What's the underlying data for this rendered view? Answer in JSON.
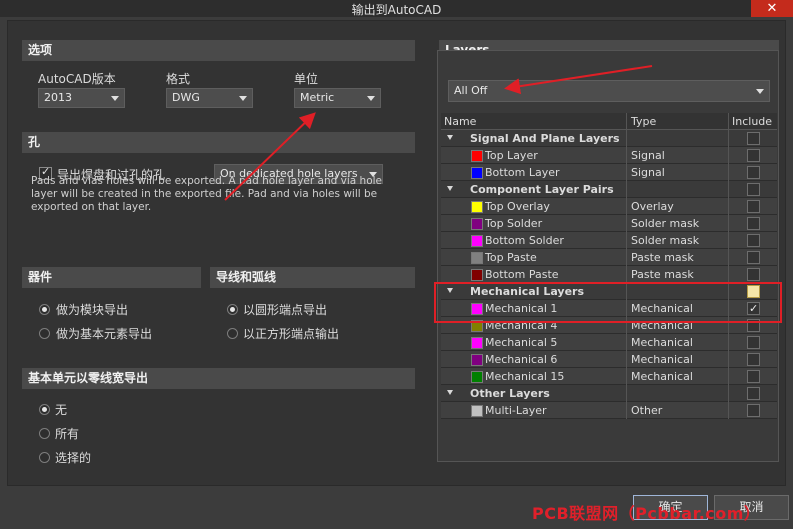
{
  "window": {
    "title": "输出到AutoCAD",
    "close_glyph": "✕"
  },
  "options": {
    "header": "选项",
    "autocad_version": {
      "label": "AutoCAD版本",
      "value": "2013"
    },
    "format": {
      "label": "格式",
      "value": "DWG"
    },
    "units": {
      "label": "单位",
      "value": "Metric"
    }
  },
  "holes": {
    "header": "孔",
    "export_checkbox_label": "导出焊盘和过孔的孔",
    "export_checked": true,
    "mode_value": "On dedicated hole layers",
    "description": "Pads and vias holes will be exported. A pad hole layer and via hole layer will be created in the exported file. Pad and via holes will be exported on that layer."
  },
  "components": {
    "header": "器件",
    "options": [
      {
        "label": "做为模块导出",
        "selected": true
      },
      {
        "label": "做为基本元素导出",
        "selected": false
      }
    ]
  },
  "tracks": {
    "header": "导线和弧线",
    "options": [
      {
        "label": "以圆形端点导出",
        "selected": true
      },
      {
        "label": "以正方形端点输出",
        "selected": false
      }
    ]
  },
  "zero_width": {
    "header": "基本单元以零线宽导出",
    "options": [
      {
        "label": "无",
        "selected": true
      },
      {
        "label": "所有",
        "selected": false
      },
      {
        "label": "选择的",
        "selected": false
      }
    ]
  },
  "layers": {
    "header": "Layers",
    "filter_value": "All Off",
    "columns": {
      "name": "Name",
      "type": "Type",
      "include": "Include"
    },
    "rows": [
      {
        "kind": "group",
        "name": "Signal And Plane Layers"
      },
      {
        "kind": "item",
        "name": "Top Layer",
        "type": "Signal",
        "color": "#ff0000",
        "include": false
      },
      {
        "kind": "item",
        "name": "Bottom Layer",
        "type": "Signal",
        "color": "#0000ff",
        "include": false
      },
      {
        "kind": "group",
        "name": "Component Layer Pairs"
      },
      {
        "kind": "item",
        "name": "Top Overlay",
        "type": "Overlay",
        "color": "#ffff00",
        "include": false
      },
      {
        "kind": "item",
        "name": "Top Solder",
        "type": "Solder mask",
        "color": "#800080",
        "include": false
      },
      {
        "kind": "item",
        "name": "Bottom Solder",
        "type": "Solder mask",
        "color": "#ff00ff",
        "include": false
      },
      {
        "kind": "item",
        "name": "Top Paste",
        "type": "Paste mask",
        "color": "#808080",
        "include": false
      },
      {
        "kind": "item",
        "name": "Bottom Paste",
        "type": "Paste mask",
        "color": "#800000",
        "include": false
      },
      {
        "kind": "group",
        "name": "Mechanical Layers",
        "highlight": true
      },
      {
        "kind": "item",
        "name": "Mechanical 1",
        "type": "Mechanical",
        "color": "#ff00ff",
        "include": true
      },
      {
        "kind": "item",
        "name": "Mechanical 4",
        "type": "Mechanical",
        "color": "#808000",
        "include": false
      },
      {
        "kind": "item",
        "name": "Mechanical 5",
        "type": "Mechanical",
        "color": "#ff00ff",
        "include": false
      },
      {
        "kind": "item",
        "name": "Mechanical 6",
        "type": "Mechanical",
        "color": "#800080",
        "include": false
      },
      {
        "kind": "item",
        "name": "Mechanical 15",
        "type": "Mechanical",
        "color": "#008000",
        "include": false
      },
      {
        "kind": "group",
        "name": "Other Layers"
      },
      {
        "kind": "item",
        "name": "Multi-Layer",
        "type": "Other",
        "color": "#c0c0c0",
        "include": false
      }
    ]
  },
  "buttons": {
    "ok": "确定",
    "cancel": "取消"
  },
  "watermark": "PCB联盟网（Pcbbar.com）",
  "colors": {
    "annotation": "#e01f26",
    "background": "#3c3c3c",
    "section": "#4a4a4a"
  }
}
